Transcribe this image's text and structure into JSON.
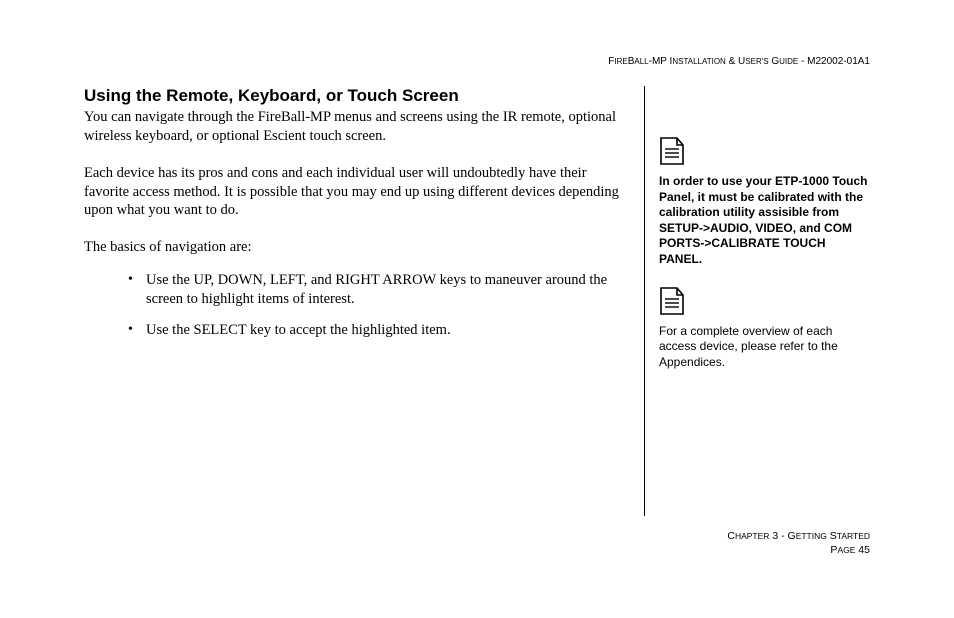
{
  "header": {
    "product_sc": "FireBall-MP I",
    "product_rest": "nstallation",
    "amp": " & U",
    "users_rest": "ser's",
    "guide_sc": " G",
    "guide_rest": "uide",
    "doc_number": " - M22002-01A1"
  },
  "main": {
    "heading": "Using the Remote, Keyboard, or Touch Screen",
    "p1": "You can navigate through the FireBall-MP menus and screens using the IR remote, optional wireless keyboard, or optional Escient touch screen.",
    "p2": "Each device has its pros and cons and each individual user will undoubtedly have their favorite access method. It is possible that you may end up using different devices depending upon what you want to do.",
    "p3": "The basics of navigation are:",
    "bullets": [
      "Use the UP, DOWN, LEFT, and RIGHT ARROW keys to maneuver around the screen to highlight items of interest.",
      "Use the SELECT key to accept the highlighted item."
    ]
  },
  "sidebar": {
    "note1": "In order to use your ETP-1000 Touch Panel, it must be cali­brated with the calibration utility assisible from SETUP->AUDIO, VIDEO, and COM PORTS->CALI­BRATE TOUCH PANEL.",
    "note2": "For a complete overview of each access device, please refer to the Appendices."
  },
  "footer": {
    "chapter_sc": "Chapter",
    "chapter_num": " 3 - G",
    "chapter_rest": "etting",
    "started_sc": " S",
    "started_rest": "tarted",
    "page_sc": "Page",
    "page_num": " 45"
  }
}
